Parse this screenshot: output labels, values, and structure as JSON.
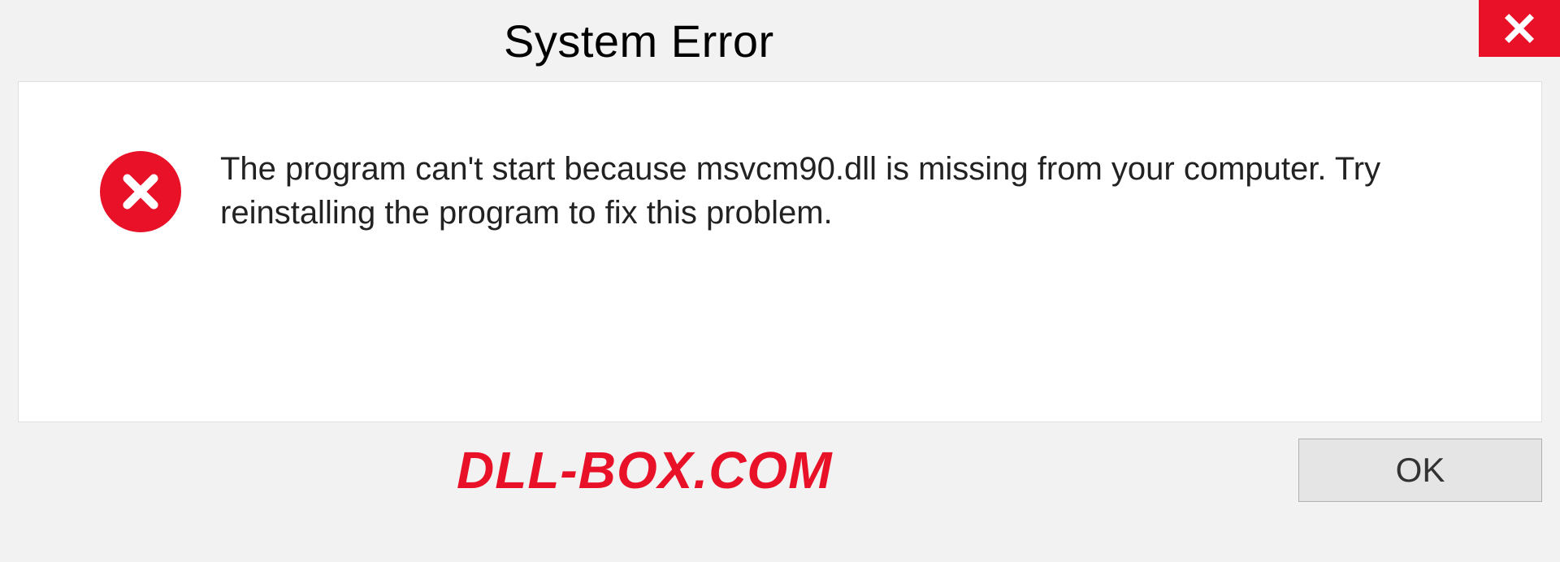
{
  "dialog": {
    "title": "System Error",
    "message": "The program can't start because msvcm90.dll is missing from your computer. Try reinstalling the program to fix this problem.",
    "ok_label": "OK"
  },
  "watermark": "DLL-BOX.COM",
  "colors": {
    "error_red": "#e81128",
    "background": "#f2f2f2"
  }
}
